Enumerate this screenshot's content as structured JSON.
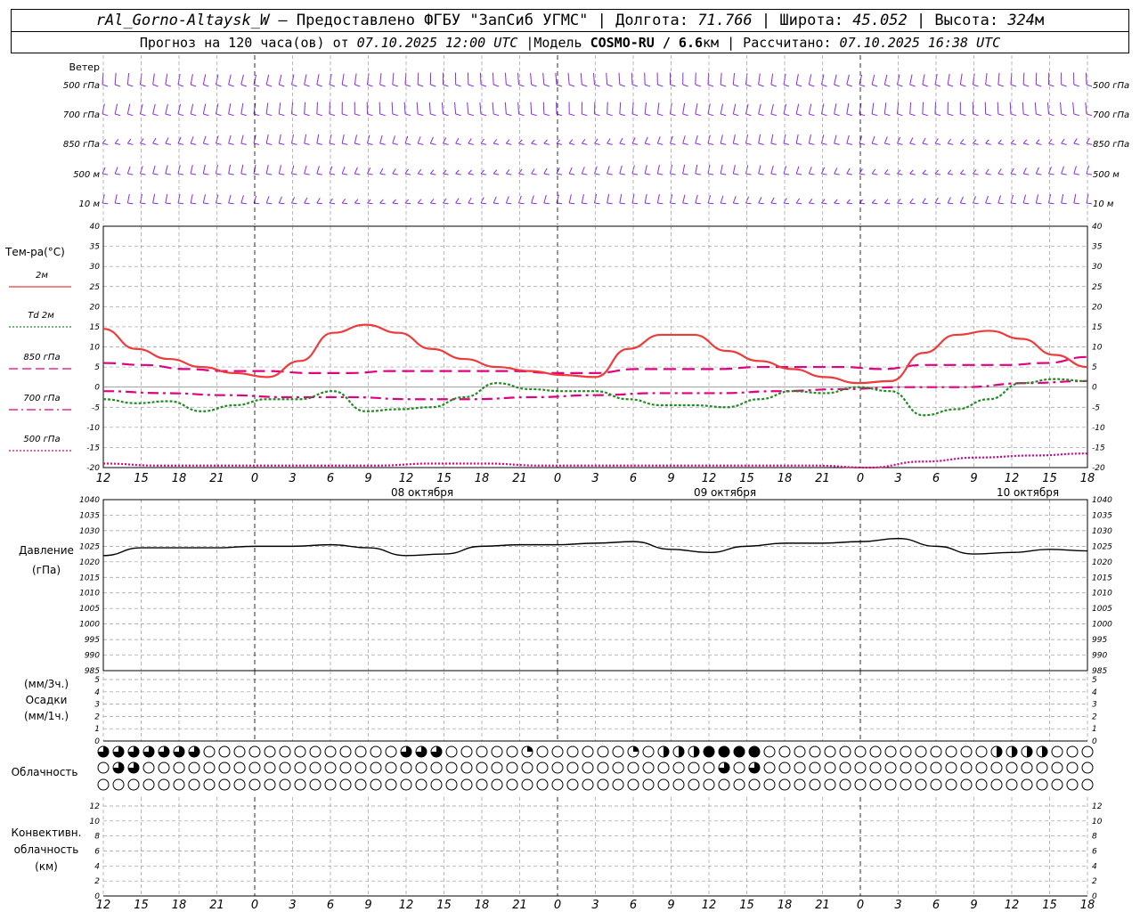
{
  "header": {
    "station": "rAl_Gorno-Altaysk_W",
    "dash": " — ",
    "provider": "Предоставлено ФГБУ \"ЗапСиб УГМС\"",
    "sep": " | ",
    "lon_label": "Долгота: ",
    "lon_value": "71.766",
    "lat_label": "Широта: ",
    "lat_value": "45.052",
    "alt_label": "Высота: ",
    "alt_value": "324",
    "alt_unit": "м",
    "forecast_text": "Прогноз на 120 часа(ов) от ",
    "forecast_time": "07.10.2025 12:00 UTC",
    "model_label": "  |Модель ",
    "model_name": "COSMO-RU / 6.6",
    "model_unit": "км",
    "calc_label": " | Рассчитано: ",
    "calc_time": "07.10.2025 16:38 UTC"
  },
  "wind_panel": {
    "title": "Ветер",
    "levels": [
      "500 гПа",
      "700 гПа",
      "850 гПа",
      "500 м",
      "10  м"
    ]
  },
  "temp_panel": {
    "title": "Тем-ра(°C)",
    "legend": [
      {
        "label": "2м",
        "color": "#ee3a3a",
        "style": "solid"
      },
      {
        "label": "Td  2м",
        "color": "#238b23",
        "style": "dotted"
      },
      {
        "label": "850 гПа",
        "color": "#e0007f",
        "style": "dashed"
      },
      {
        "label": "700 гПа",
        "color": "#e0007f",
        "style": "dashdot"
      },
      {
        "label": "500 гПа",
        "color": "#e0007f",
        "style": "dotted"
      }
    ],
    "y_ticks": [
      "40",
      "35",
      "30",
      "25",
      "20",
      "15",
      "10",
      "5",
      "0",
      "-5",
      "-10",
      "-15",
      "-20"
    ]
  },
  "date_labels": [
    "08 октября",
    "09 октября",
    "10 октября"
  ],
  "hour_labels": [
    "12",
    "15",
    "18",
    "21",
    "0",
    "3",
    "6",
    "9",
    "12",
    "15",
    "18",
    "21",
    "0",
    "3",
    "6",
    "9",
    "12",
    "15",
    "18",
    "21",
    "0",
    "3",
    "6",
    "9",
    "12",
    "15",
    "18"
  ],
  "pressure_panel": {
    "title": "Давление",
    "unit": "(гПа)",
    "y_ticks": [
      "1040",
      "1035",
      "1030",
      "1025",
      "1020",
      "1015",
      "1010",
      "1005",
      "1000",
      "995",
      "990",
      "985"
    ]
  },
  "precip_panel": {
    "unit3": "(мм/3ч.)",
    "title": "Осадки",
    "unit1": "(мм/1ч.)",
    "y_ticks": [
      "5",
      "4",
      "3",
      "2",
      "1",
      "0"
    ]
  },
  "cloud_panel": {
    "title": "Облачность"
  },
  "conv_panel": {
    "title1": "Конвективн.",
    "title2": "облачность",
    "unit": "(км)",
    "y_ticks": [
      "12",
      "10",
      "8",
      "6",
      "4",
      "2",
      "0"
    ]
  },
  "chart_data": {
    "type": "line",
    "x_hours": [
      0,
      3,
      6,
      9,
      12,
      15,
      18,
      21,
      24,
      27,
      30,
      33,
      36,
      39,
      42,
      45,
      48,
      51,
      54,
      57,
      60,
      63,
      66,
      69,
      72,
      75,
      78
    ],
    "series": [
      {
        "name": "2м",
        "color": "#ee3a3a",
        "values": [
          14.5,
          9.5,
          7.0,
          5.0,
          3.5,
          2.5,
          6.5,
          13.5,
          15.5,
          13.5,
          9.5,
          7.0,
          5.0,
          4.0,
          3.0,
          2.5,
          9.5,
          13.0,
          13.0,
          9.0,
          6.5,
          4.5,
          2.5,
          1.0,
          1.5,
          8.5,
          13.0,
          14.0,
          12.0,
          8.0,
          5.0
        ]
      },
      {
        "name": "Td  2м",
        "color": "#238b23",
        "values": [
          -3.0,
          -4.0,
          -3.5,
          -6.0,
          -4.5,
          -3.0,
          -3.0,
          -1.0,
          -6.0,
          -5.5,
          -5.0,
          -2.5,
          1.0,
          -0.5,
          -1.0,
          -1.0,
          -3.0,
          -4.5,
          -4.5,
          -5.0,
          -3.0,
          -1.0,
          -1.5,
          0.0,
          -1.0,
          -7.0,
          -5.5,
          -3.0,
          1.0,
          2.0,
          1.5
        ]
      },
      {
        "name": "850 гПа",
        "color": "#e0007f",
        "values": [
          6.0,
          5.5,
          4.5,
          4.0,
          4.0,
          3.5,
          3.5,
          4.0,
          4.0,
          4.0,
          4.0,
          3.5,
          3.5,
          4.5,
          4.5,
          4.5,
          5.0,
          5.0,
          5.0,
          4.5,
          5.5,
          5.5,
          5.5,
          6.0,
          7.5
        ]
      },
      {
        "name": "700 гПа",
        "color": "#e0007f",
        "values": [
          -1.0,
          -1.5,
          -2.0,
          -2.5,
          -2.5,
          -3.0,
          -3.0,
          -2.5,
          -2.0,
          -1.5,
          -1.5,
          -1.0,
          -0.5,
          0.0,
          0.0,
          1.0,
          1.5
        ]
      },
      {
        "name": "500 гПа",
        "color": "#e0007f",
        "values": [
          -19.0,
          -19.5,
          -19.5,
          -19.5,
          -19.5,
          -19.5,
          -19.0,
          -19.0,
          -19.5,
          -19.5,
          -19.5,
          -19.5,
          -19.5,
          -19.5,
          -20.0,
          -18.5,
          -17.5,
          -17.0,
          -16.5
        ]
      },
      {
        "name": "Давление",
        "color": "#000000",
        "values": [
          1022.0,
          1024.5,
          1024.5,
          1024.5,
          1025.0,
          1025.0,
          1025.5,
          1024.5,
          1022.0,
          1022.5,
          1025.0,
          1025.5,
          1025.5,
          1026.0,
          1026.5,
          1024.0,
          1023.0,
          1025.0,
          1026.0,
          1026.0,
          1026.5,
          1027.5,
          1025.0,
          1022.5,
          1023.0,
          1024.0,
          1023.5
        ]
      }
    ],
    "temp_ylim": [
      -20,
      40
    ],
    "pressure_ylim": [
      985,
      1040
    ],
    "precip_ylim": [
      0,
      5
    ],
    "conv_ylim": [
      0,
      13
    ],
    "xlabel": "",
    "grid": true
  }
}
